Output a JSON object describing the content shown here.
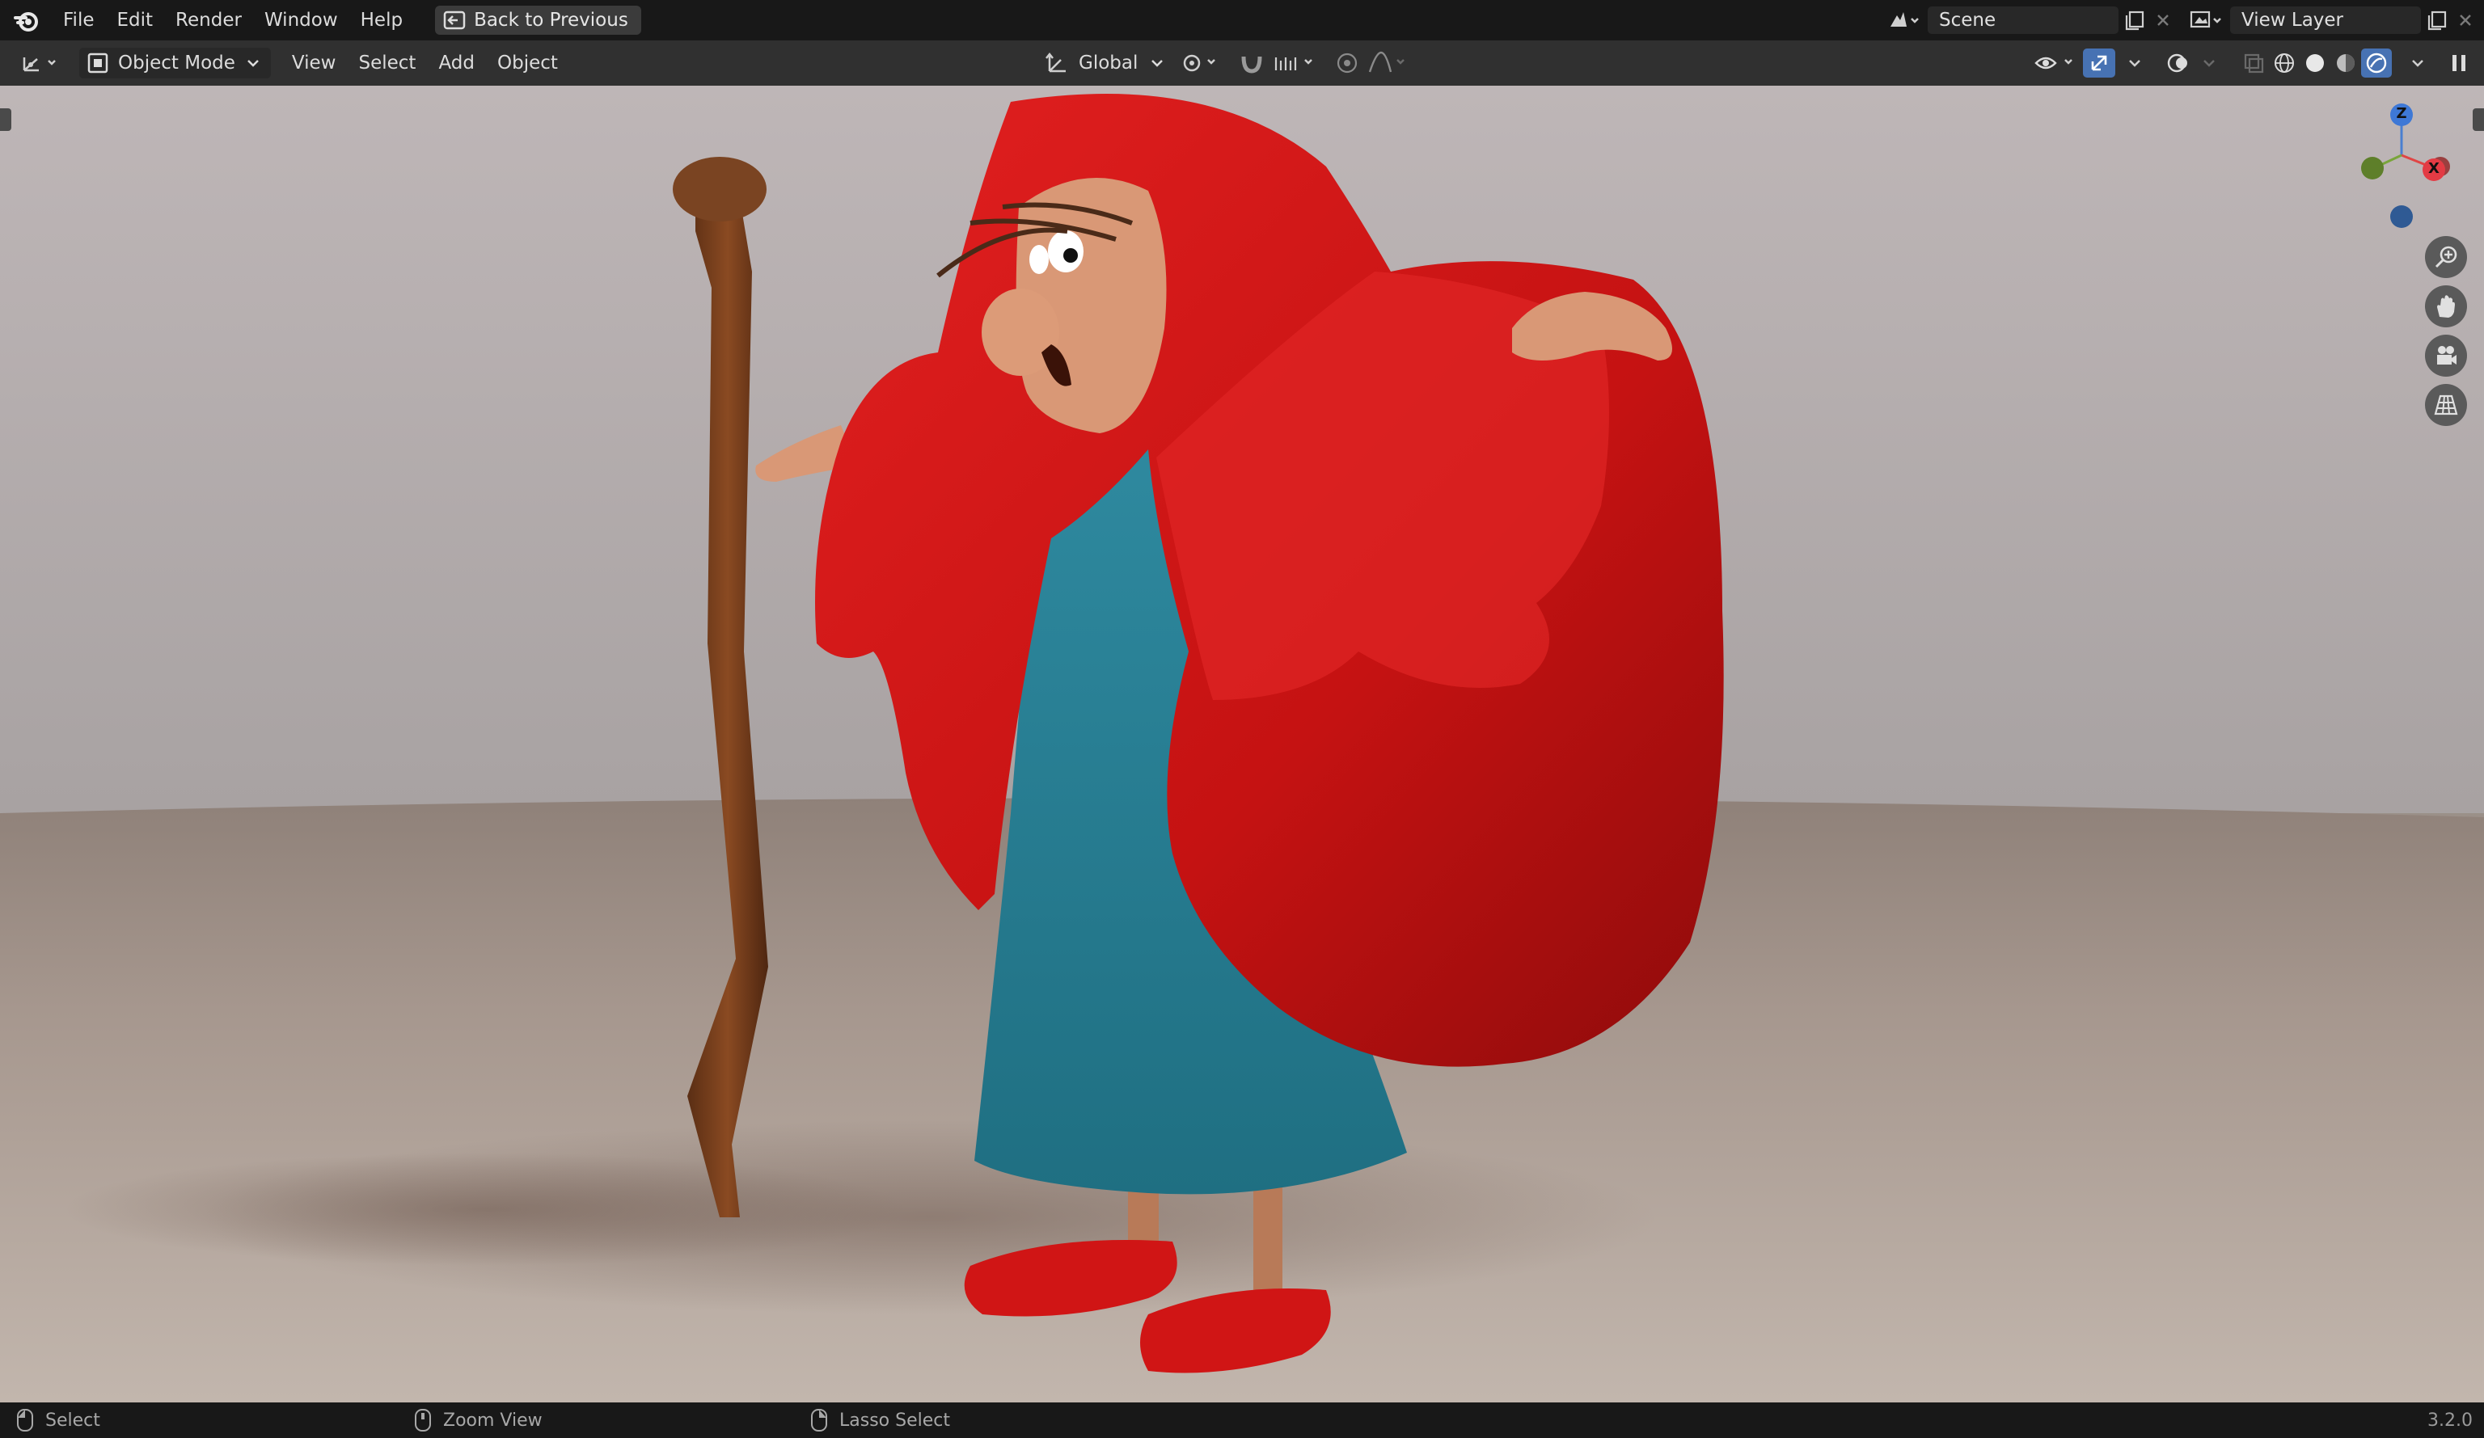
{
  "topbar": {
    "menus": [
      "File",
      "Edit",
      "Render",
      "Window",
      "Help"
    ],
    "back_label": "Back to Previous",
    "scene": "Scene",
    "view_layer": "View Layer"
  },
  "header": {
    "mode": "Object Mode",
    "menus": [
      "View",
      "Select",
      "Add",
      "Object"
    ],
    "orientation": "Global"
  },
  "gizmo": {
    "z": "Z",
    "x": "X"
  },
  "status": {
    "select": "Select",
    "zoom": "Zoom View",
    "lasso": "Lasso Select",
    "version": "3.2.0"
  },
  "colors": {
    "topbar": "#181818",
    "header": "#303030",
    "accent_blue": "#4772b3",
    "cloak_red": "#d01515",
    "dress_blue": "#2a7f93"
  }
}
